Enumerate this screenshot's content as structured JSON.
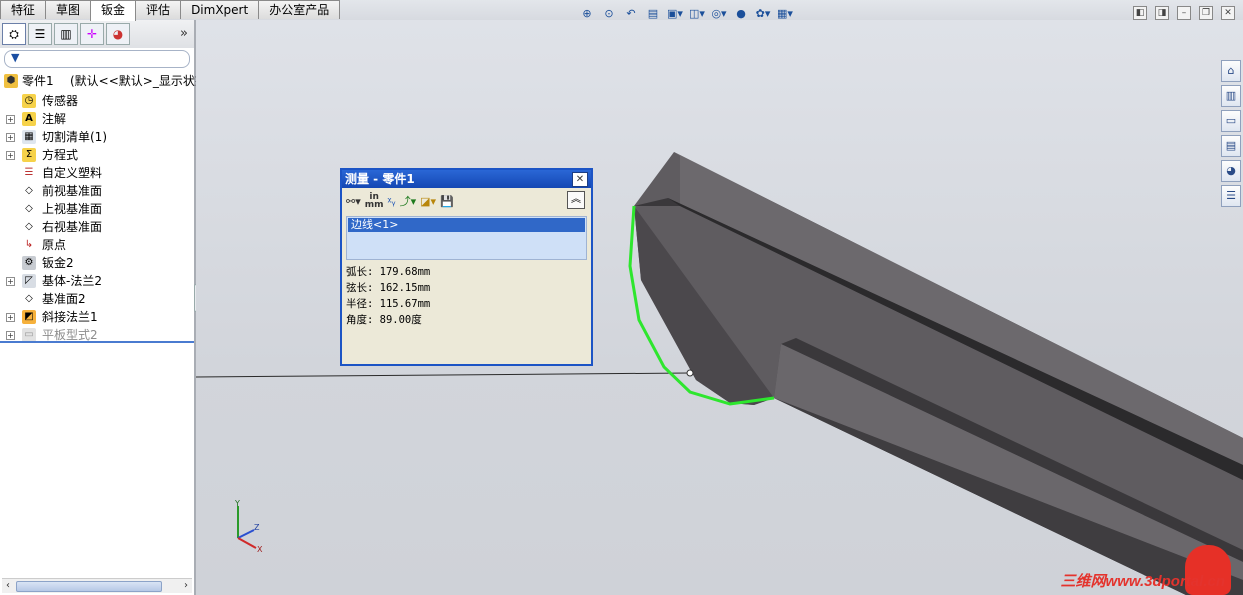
{
  "tabs": [
    "特征",
    "草图",
    "钣金",
    "评估",
    "DimXpert",
    "办公室产品"
  ],
  "active_tab": "钣金",
  "feature_tree": {
    "root_label": "零件1",
    "root_config": "(默认<<默认>_显示状态",
    "items": [
      {
        "label": "传感器",
        "icon": "sensor-icon",
        "expandable": false
      },
      {
        "label": "注解",
        "icon": "annotation-icon",
        "expandable": true
      },
      {
        "label": "切割清单(1)",
        "icon": "cutlist-icon",
        "expandable": true
      },
      {
        "label": "方程式",
        "icon": "equation-icon",
        "expandable": true
      },
      {
        "label": "自定义塑料",
        "icon": "material-icon",
        "expandable": false
      },
      {
        "label": "前视基准面",
        "icon": "plane-icon",
        "expandable": false
      },
      {
        "label": "上视基准面",
        "icon": "plane-icon",
        "expandable": false
      },
      {
        "label": "右视基准面",
        "icon": "plane-icon",
        "expandable": false
      },
      {
        "label": "原点",
        "icon": "origin-icon",
        "expandable": false
      },
      {
        "label": "钣金2",
        "icon": "sheetmetal-icon",
        "expandable": false
      },
      {
        "label": "基体-法兰2",
        "icon": "base-flange-icon",
        "expandable": true
      },
      {
        "label": "基准面2",
        "icon": "plane-icon",
        "expandable": false
      },
      {
        "label": "斜接法兰1",
        "icon": "miter-flange-icon",
        "expandable": true
      },
      {
        "label": "平板型式2",
        "icon": "flat-pattern-icon",
        "expandable": true,
        "suppressed": true
      }
    ]
  },
  "measure_dialog": {
    "title": "测量 - 零件1",
    "toolbar_unit_top": "in",
    "toolbar_unit_bottom": "mm",
    "selection": "边线<1>",
    "arc_length": "弧长: 179.68mm",
    "chord_length": "弦长: 162.15mm",
    "radius": "半径: 115.67mm",
    "angle": "角度: 89.00度"
  },
  "triad": {
    "x": "X",
    "y": "Y",
    "z": "Z"
  },
  "watermark": "三维网www.3dportal.cn",
  "colors": {
    "selected_edge": "#2ee62e",
    "dialog_title": "#1c54c5",
    "tree_separator": "#4a7bd0"
  }
}
